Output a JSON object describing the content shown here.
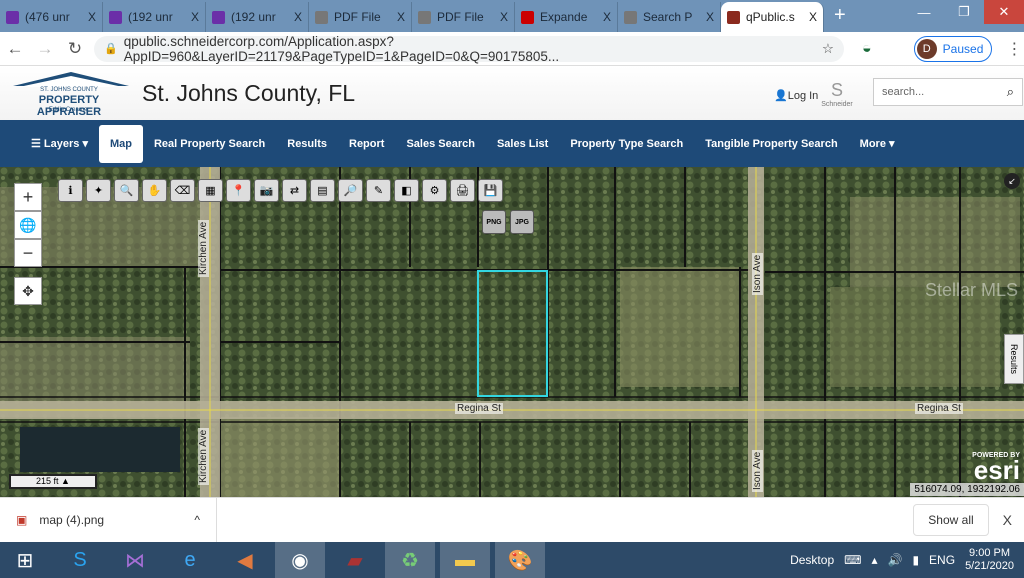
{
  "browser": {
    "tabs": [
      {
        "label": "(476 unr",
        "icon": "mail-icon",
        "color": "#6b2fa8"
      },
      {
        "label": "(192 unr",
        "icon": "mail-icon",
        "color": "#6b2fa8"
      },
      {
        "label": "(192 unr",
        "icon": "mail-icon",
        "color": "#6b2fa8"
      },
      {
        "label": "PDF File",
        "icon": "globe-icon",
        "color": "#777"
      },
      {
        "label": "PDF File",
        "icon": "globe-icon",
        "color": "#777"
      },
      {
        "label": "Expande",
        "icon": "netflix-icon",
        "color": "#c00"
      },
      {
        "label": "Search P",
        "icon": "globe-icon",
        "color": "#777"
      },
      {
        "label": "qPublic.s",
        "icon": "qpublic-icon",
        "color": "#8b2a1e",
        "active": true
      }
    ],
    "close_glyph": "X",
    "new_tab": "+",
    "url": "qpublic.schneidercorp.com/Application.aspx?AppID=960&LayerID=21179&PageTypeID=1&PageID=0&Q=90175805...",
    "profile_initial": "D",
    "profile_status": "Paused"
  },
  "header": {
    "logo_top": "ST. JOHNS COUNTY",
    "logo_main": "PROPERTY APPRAISER",
    "logo_sub": "Eddie Creamer",
    "title": "St. Johns County, FL",
    "login": "Log In",
    "schneider": "Schneider",
    "search_placeholder": "search..."
  },
  "menu": [
    {
      "label": "☰ Layers ▾"
    },
    {
      "label": "Map",
      "active": true
    },
    {
      "label": "Real Property Search"
    },
    {
      "label": "Results"
    },
    {
      "label": "Report"
    },
    {
      "label": "Sales Search"
    },
    {
      "label": "Sales List"
    },
    {
      "label": "Property Type Search"
    },
    {
      "label": "Tangible Property Search"
    },
    {
      "label": "More ▾"
    }
  ],
  "map": {
    "tools": [
      "ℹ",
      "✦",
      "🔍",
      "✋",
      "⌫",
      "▦",
      "📍",
      "📷",
      "⇄",
      "▤",
      "🔎",
      "✎",
      "◧",
      "⚙",
      "🖨",
      "💾"
    ],
    "export_png": "PNG",
    "export_jpg": "JPG",
    "roads": {
      "kirchen": "Kirchen Ave",
      "regina1": "Regina St",
      "regina2": "Regina St",
      "ison": "Ison Ave"
    },
    "scale": "215 ft ▲",
    "coords": "516074.09, 1932192.06",
    "powered_by": "POWERED BY",
    "esri": "esri",
    "results_tab": "Results",
    "watermark": "Stellar MLS",
    "highlight_color": "#33d6e0"
  },
  "downloads": {
    "file": "map (4).png",
    "show_all": "Show all",
    "close": "X"
  },
  "taskbar": {
    "desktop": "Desktop",
    "lang": "ENG",
    "time": "9:00 PM",
    "date": "5/21/2020"
  }
}
